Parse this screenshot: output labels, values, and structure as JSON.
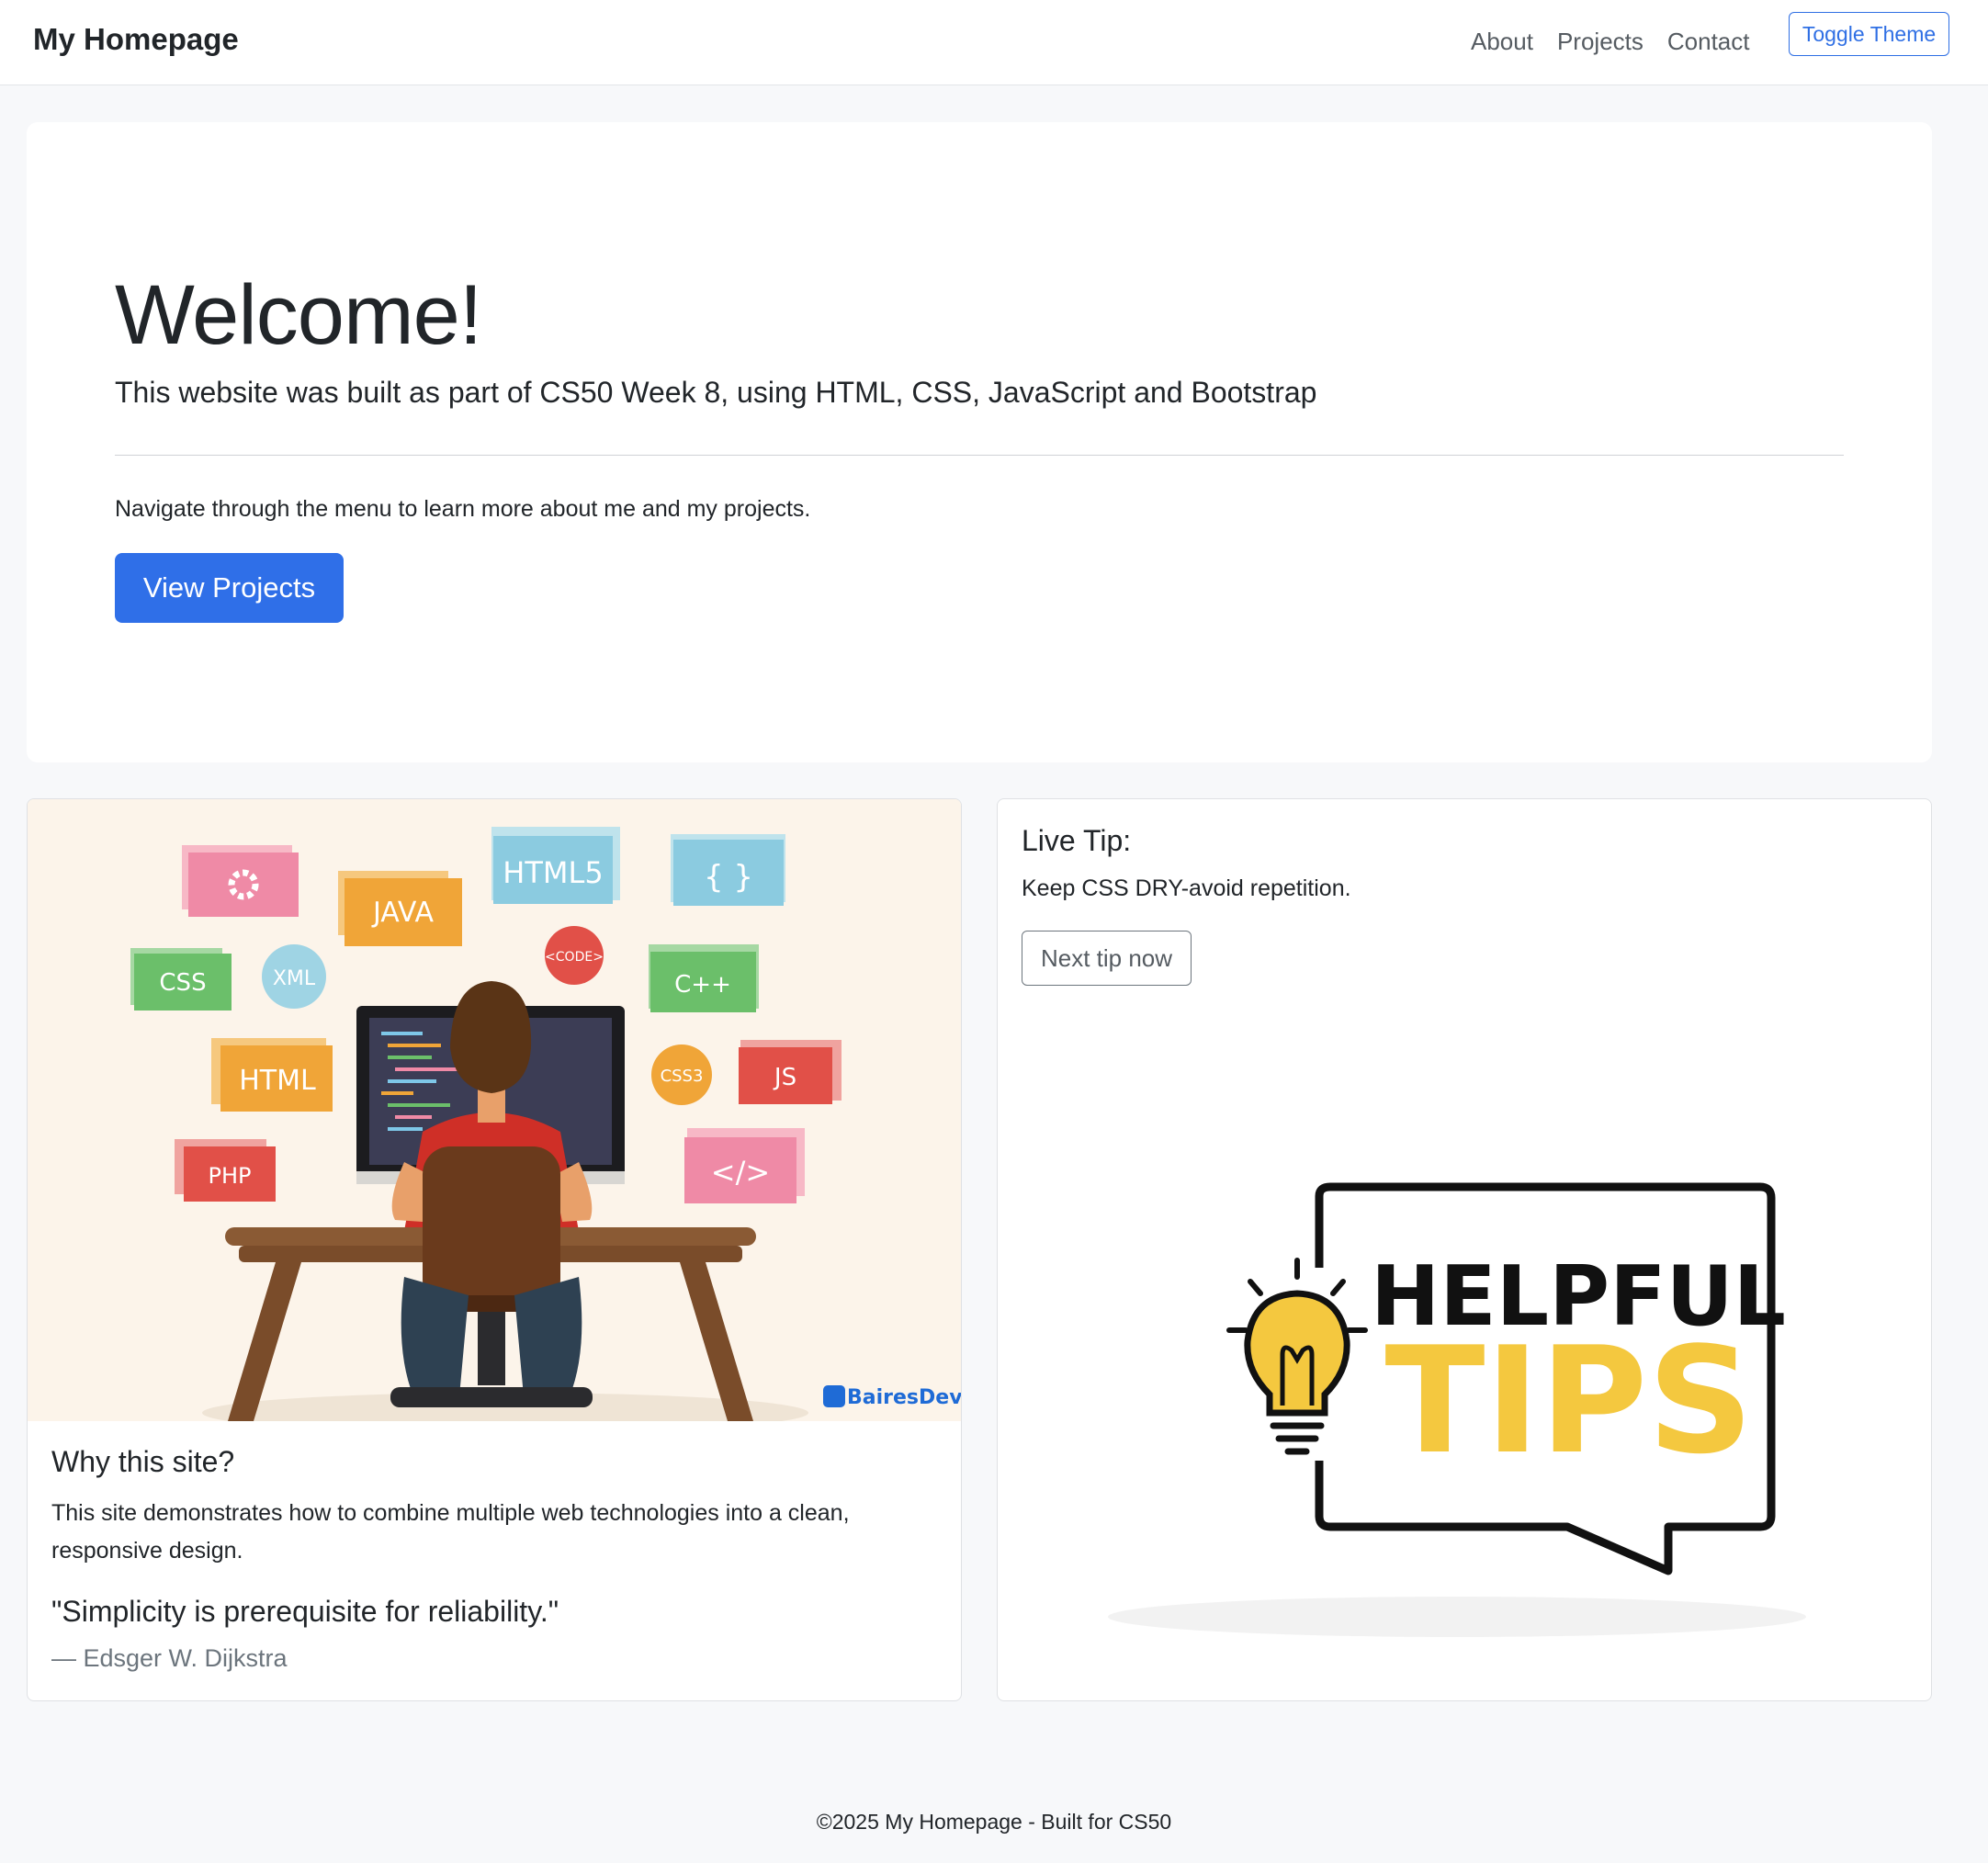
{
  "navbar": {
    "brand": "My Homepage",
    "links": [
      "About",
      "Projects",
      "Contact"
    ],
    "toggle_label": "Toggle Theme",
    "accent_color": "#2f6fe4"
  },
  "hero": {
    "title": "Welcome!",
    "lead": "This website was built as part of CS50 Week 8, using HTML, CSS, JavaScript and Bootstrap",
    "text": "Navigate through the menu to learn more about me and my projects.",
    "button_label": "View Projects",
    "button_color": "#2f6fe8"
  },
  "card_left": {
    "illustration": {
      "icon_name": "developer-at-computer-illustration",
      "labels": [
        "JAVA",
        "HTML5",
        "{ }",
        "CSS",
        "XML",
        "<CODE>",
        "C++",
        "HTML",
        "CSS3",
        "JS",
        "PHP",
        "</>"
      ],
      "watermark": "BairesDev"
    },
    "title": "Why this site?",
    "text": "This site demonstrates how to combine multiple web technologies into a clean, responsive design.",
    "quote": "\"Simplicity is prerequisite for reliability.\"",
    "quote_author": "— Edsger W. Dijkstra"
  },
  "card_right": {
    "title": "Live Tip:",
    "tip": "Keep CSS DRY-avoid repetition.",
    "button_label": "Next tip now",
    "art": {
      "icon_name": "lightbulb-speech-bubble-icon",
      "line1": "HELPFUL",
      "line2": "TIPS",
      "accent_color": "#f4c83f"
    }
  },
  "footer": {
    "text": "©2025 My Homepage - Built for CS50"
  }
}
